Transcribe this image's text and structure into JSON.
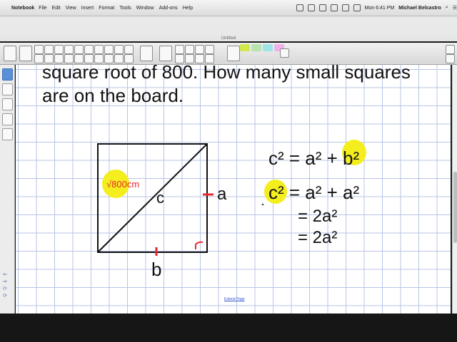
{
  "menubar": {
    "app_name": "Notebook",
    "items": [
      "File",
      "Edit",
      "View",
      "Insert",
      "Format",
      "Tools",
      "Window",
      "Add-ons",
      "Help"
    ],
    "clock": "Mon 6:41 PM",
    "user": "Michael Belcastro"
  },
  "window": {
    "title": "Untitled"
  },
  "page": {
    "question": "square root of 800. How many small squares\nare on the board.",
    "extend_link": "Extend Page"
  },
  "diagram": {
    "hypotenuse_label": "√800cm",
    "side_right_label": "a",
    "side_bottom_label": "b",
    "diagonal_label": "c",
    "highlight_color": "#f4ee1e",
    "ink_red": "#e8262f"
  },
  "equations": {
    "line1": "c² = a² + b²",
    "line2": "c² = a² + a²",
    "line3": "= 2a²",
    "line4": "= 2a²"
  },
  "icons": [
    "apple-icon",
    "undo-icon",
    "redo-icon",
    "pen-icon",
    "eraser-icon",
    "select-icon",
    "page-sorter-icon",
    "gallery-icon",
    "attachments-icon",
    "properties-icon"
  ]
}
